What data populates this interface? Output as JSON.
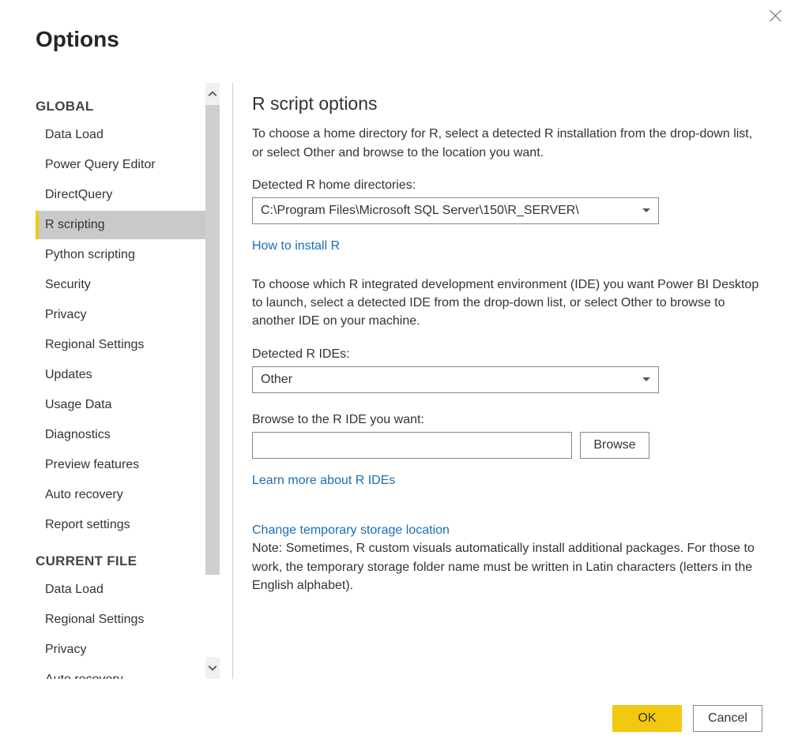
{
  "dialog": {
    "title": "Options"
  },
  "sidebar": {
    "sections": [
      {
        "header": "GLOBAL",
        "items": [
          {
            "label": "Data Load",
            "selected": false
          },
          {
            "label": "Power Query Editor",
            "selected": false
          },
          {
            "label": "DirectQuery",
            "selected": false
          },
          {
            "label": "R scripting",
            "selected": true
          },
          {
            "label": "Python scripting",
            "selected": false
          },
          {
            "label": "Security",
            "selected": false
          },
          {
            "label": "Privacy",
            "selected": false
          },
          {
            "label": "Regional Settings",
            "selected": false
          },
          {
            "label": "Updates",
            "selected": false
          },
          {
            "label": "Usage Data",
            "selected": false
          },
          {
            "label": "Diagnostics",
            "selected": false
          },
          {
            "label": "Preview features",
            "selected": false
          },
          {
            "label": "Auto recovery",
            "selected": false
          },
          {
            "label": "Report settings",
            "selected": false
          }
        ]
      },
      {
        "header": "CURRENT FILE",
        "items": [
          {
            "label": "Data Load",
            "selected": false
          },
          {
            "label": "Regional Settings",
            "selected": false
          },
          {
            "label": "Privacy",
            "selected": false
          },
          {
            "label": "Auto recovery",
            "selected": false
          }
        ]
      }
    ]
  },
  "content": {
    "heading": "R script options",
    "intro": "To choose a home directory for R, select a detected R installation from the drop-down list, or select Other and browse to the location you want.",
    "home_dir_label": "Detected R home directories:",
    "home_dir_value": "C:\\Program Files\\Microsoft SQL Server\\150\\R_SERVER\\",
    "install_link": "How to install R",
    "ide_intro": "To choose which R integrated development environment (IDE) you want Power BI Desktop to launch, select a detected IDE from the drop-down list, or select Other to browse to another IDE on your machine.",
    "ide_label": "Detected R IDEs:",
    "ide_value": "Other",
    "browse_label": "Browse to the R IDE you want:",
    "browse_value": "",
    "browse_button": "Browse",
    "learn_link": "Learn more about R IDEs",
    "temp_link": "Change temporary storage location",
    "temp_note": "Note: Sometimes, R custom visuals automatically install additional packages. For those to work, the temporary storage folder name must be written in Latin characters (letters in the English alphabet)."
  },
  "footer": {
    "ok": "OK",
    "cancel": "Cancel"
  }
}
